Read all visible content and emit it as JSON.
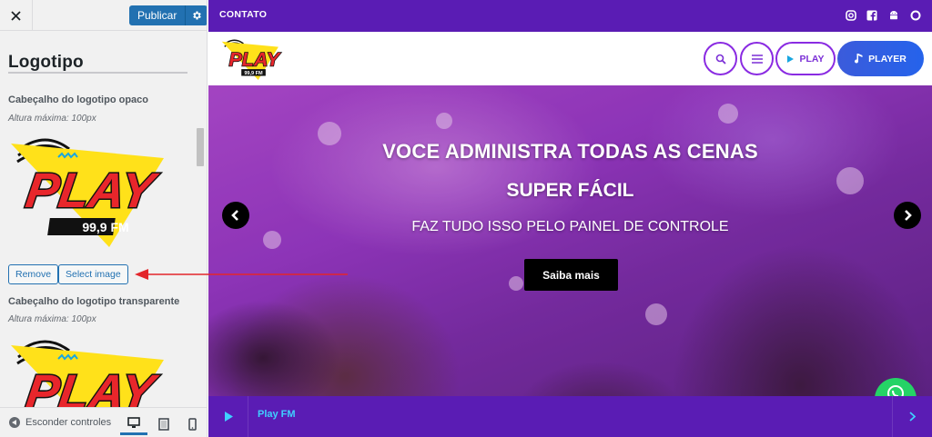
{
  "customizer": {
    "publish_label": "Publicar",
    "section_title": "Logotipo",
    "opaque": {
      "label": "Cabeçalho do logotipo opaco",
      "description": "Altura máxima: 100px"
    },
    "remove_label": "Remove",
    "select_image_label": "Select image",
    "transparent": {
      "label": "Cabeçalho do logotipo transparente",
      "description": "Altura máxima: 100px"
    },
    "hide_controls_label": "Esconder controles"
  },
  "logo": {
    "word": "PLAY",
    "frequency": "99,9 FM",
    "colors": {
      "red": "#e8262b",
      "yellow": "#ffe11a",
      "black": "#111111"
    }
  },
  "site": {
    "topbar": {
      "contact_label": "CONTATO"
    },
    "social_icons": [
      "instagram-icon",
      "facebook-icon",
      "android-icon",
      "circle-icon"
    ],
    "header": {
      "play_label": "PLAY",
      "player_label": "PLAYER"
    },
    "hero": {
      "title_line1": "VOCE ADMINISTRA TODAS AS CENAS",
      "title_line2": "SUPER FÁCIL",
      "subtitle": "FAZ TUDO ISSO PELO PAINEL DE CONTROLE",
      "cta_label": "Saiba mais"
    },
    "player_bar": {
      "station": "Play FM"
    },
    "colors": {
      "purple": "#5a1cb4",
      "accent": "#8a2be2",
      "player_blue": "#2563eb",
      "link_cyan": "#3fd0ff",
      "whatsapp": "#25d366"
    }
  }
}
